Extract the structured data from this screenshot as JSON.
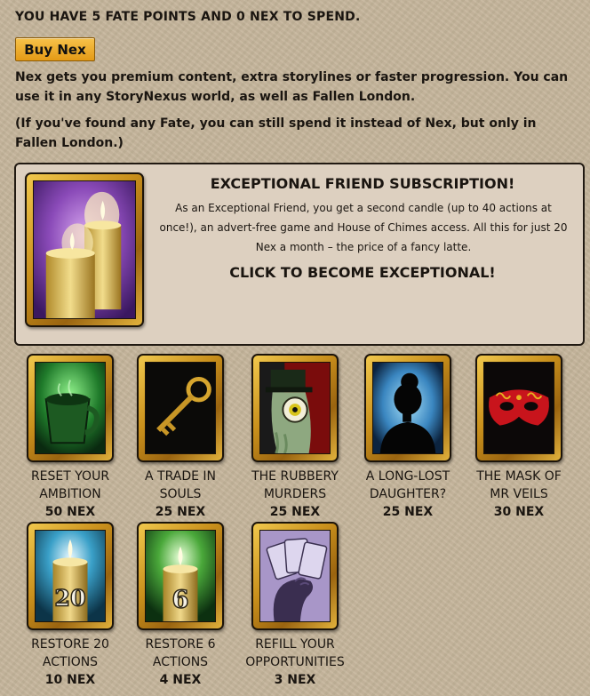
{
  "header": {
    "fate_line": "YOU HAVE 5 FATE POINTS AND 0 NEX TO SPEND.",
    "buy_button": "Buy Nex",
    "paragraph1": "Nex gets you premium content, extra storylines or faster progression. You can use it in any StoryNexus world, as well as Fallen London.",
    "paragraph2": "(If you've found any Fate, you can still spend it instead of Nex, but only in Fallen London.)"
  },
  "subscription": {
    "title": "EXCEPTIONAL FRIEND SUBSCRIPTION!",
    "description": "As an Exceptional Friend, you get a second candle (up to 40 actions at once!), an advert-free game and House of Chimes access. All this for just 20 Nex a month – the price of a fancy latte.",
    "cta": "CLICK TO BECOME EXCEPTIONAL!",
    "icon": "candles-icon"
  },
  "items": [
    {
      "name": "RESET YOUR AMBITION",
      "price": "50 NEX",
      "icon": "green-cup-icon"
    },
    {
      "name": "A TRADE IN SOULS",
      "price": "25 NEX",
      "icon": "golden-key-icon"
    },
    {
      "name": "THE RUBBERY MURDERS",
      "price": "25 NEX",
      "icon": "rubbery-man-icon"
    },
    {
      "name": "A LONG-LOST DAUGHTER?",
      "price": "25 NEX",
      "icon": "silhouette-icon"
    },
    {
      "name": "THE MASK OF MR VEILS",
      "price": "30 NEX",
      "icon": "red-mask-icon"
    },
    {
      "name": "RESTORE 20 ACTIONS",
      "price": "10 NEX",
      "icon": "candle-20-icon",
      "candle_number": "20"
    },
    {
      "name": "RESTORE 6 ACTIONS",
      "price": "4 NEX",
      "icon": "candle-6-icon",
      "candle_number": "6"
    },
    {
      "name": "REFILL YOUR OPPORTUNITIES",
      "price": "3 NEX",
      "icon": "cards-hand-icon"
    }
  ]
}
